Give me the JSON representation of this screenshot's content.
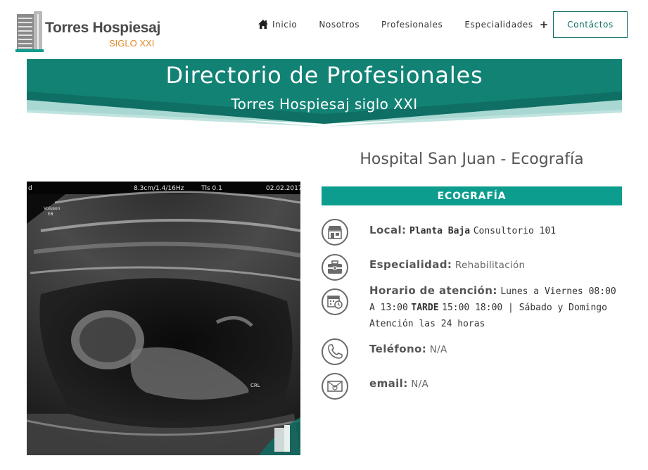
{
  "header": {
    "logo_title": "Torres Hospiesaj",
    "logo_subtitle": "SIGLO XXI",
    "nav": [
      {
        "label": "Inicio"
      },
      {
        "label": "Nosotros"
      },
      {
        "label": "Profesionales"
      },
      {
        "label": "Especialidades"
      }
    ],
    "nav_plus": "+",
    "contact_label": "Contáctos"
  },
  "banner": {
    "title": "Directorio de Profesionales",
    "subtitle": "Torres Hospiesaj siglo XXI"
  },
  "image": {
    "overlay": {
      "corner": "d",
      "params": "8.3cm/1.4/16Hz",
      "tis": "Tls 0.1",
      "date": "02.02.2017",
      "brand": "Voluson",
      "brand_sub": "E8",
      "crl": "CRL"
    }
  },
  "info": {
    "hospital_title": "Hospital San Juan - Ecografía",
    "specialty_header": "ECOGRAFÍA",
    "local_label": "Local:",
    "local_value_bold": "Planta Baja",
    "local_value": "Consultorio 101",
    "especialidad_label": "Especialidad:",
    "especialidad_value": "Rehabilitación",
    "horario_label": "Horario de atención:",
    "horario_part1": "Lunes a Viernes 08:00 A 13:00",
    "horario_bold": "TARDE",
    "horario_part2": "15:00 18:00 | Sábado y Domingo Atención las 24 horas",
    "telefono_label": "Teléfono:",
    "telefono_value": "N/A",
    "email_label": "email:",
    "email_value": "N/A"
  },
  "colors": {
    "teal": "#0c9d8f",
    "dark_teal": "#0f6f65",
    "accent_orange": "#e08a2c"
  },
  "icons": {
    "home": "home-icon",
    "local": "store-icon",
    "especialidad": "briefcase-icon",
    "horario": "calendar-clock-icon",
    "telefono": "phone-icon",
    "email": "email-icon"
  }
}
